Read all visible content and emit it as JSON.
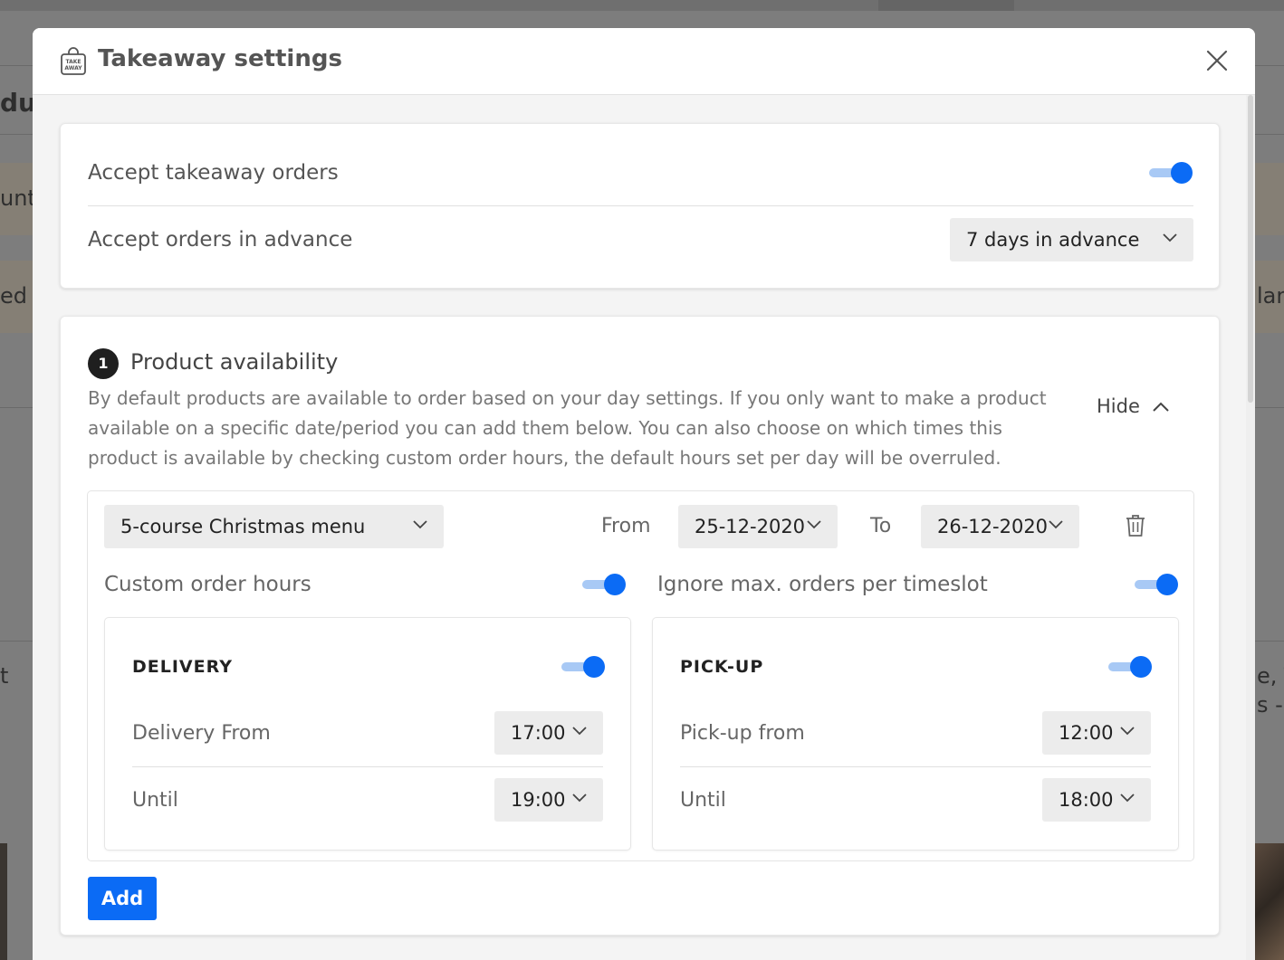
{
  "background": {
    "texts": [
      "duc",
      "unt",
      "ed T",
      "lan",
      "t",
      "e, T",
      "s -"
    ]
  },
  "modal": {
    "title": "Takeaway settings",
    "header_icon_text": "TAKE AWAY"
  },
  "general": {
    "accept_takeaway_label": "Accept takeaway orders",
    "accept_takeaway_on": true,
    "accept_advance_label": "Accept orders in advance",
    "advance_value": "7 days in advance"
  },
  "availability": {
    "step_number": "1",
    "title": "Product availability",
    "description": "By default products are available to order based on your day settings. If you only want to make a product available on a specific date/period you can add them below. You can also choose on which times this product is available by checking custom order hours, the default hours set per day will be overruled.",
    "hide_label": "Hide",
    "item": {
      "product": "5-course Christmas menu",
      "from_label": "From",
      "from_date": "25-12-2020",
      "to_label": "To",
      "to_date": "26-12-2020",
      "custom_hours_label": "Custom order hours",
      "custom_hours_on": true,
      "ignore_max_label": "Ignore max. orders per timeslot",
      "ignore_max_on": true,
      "delivery": {
        "title": "DELIVERY",
        "enabled": true,
        "from_label": "Delivery From",
        "from_value": "17:00",
        "until_label": "Until",
        "until_value": "19:00"
      },
      "pickup": {
        "title": "PICK-UP",
        "enabled": true,
        "from_label": "Pick-up from",
        "from_value": "12:00",
        "until_label": "Until",
        "until_value": "18:00"
      }
    },
    "add_label": "Add"
  },
  "colors": {
    "accent": "#0b6bf5",
    "toggle_track": "#a8c9f5"
  }
}
